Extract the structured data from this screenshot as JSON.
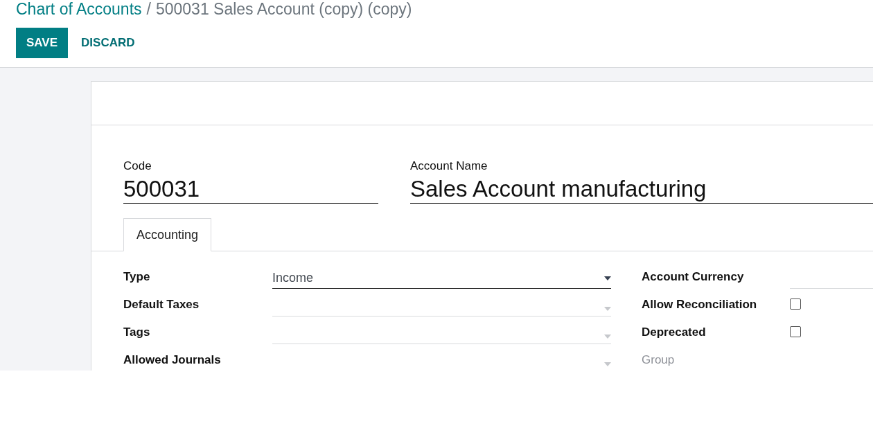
{
  "breadcrumb": {
    "parent": "Chart of Accounts",
    "separator": "/",
    "current": "500031 Sales Account (copy) (copy)"
  },
  "buttons": [
    {
      "label": "SAVE",
      "kind": "primary"
    },
    {
      "label": "DISCARD",
      "kind": "link"
    }
  ],
  "header_fields": [
    {
      "label": "Code",
      "value": "500031"
    },
    {
      "label": "Account Name",
      "value": "Sales Account manufacturing"
    }
  ],
  "tabs": [
    {
      "label": "Accounting",
      "selected": true
    }
  ],
  "left_fields": [
    {
      "label": "Type",
      "value": "Income"
    },
    {
      "label": "Default Taxes"
    },
    {
      "label": "Tags"
    },
    {
      "label": "Allowed Journals"
    }
  ],
  "right_fields": [
    {
      "label": "Account Currency",
      "kind": "text",
      "disabled": false
    },
    {
      "label": "Allow Reconciliation",
      "kind": "checkbox",
      "checked": false,
      "disabled": false
    },
    {
      "label": "Deprecated",
      "kind": "checkbox",
      "checked": false,
      "disabled": false
    },
    {
      "label": "Group",
      "kind": "none",
      "disabled": true
    }
  ]
}
